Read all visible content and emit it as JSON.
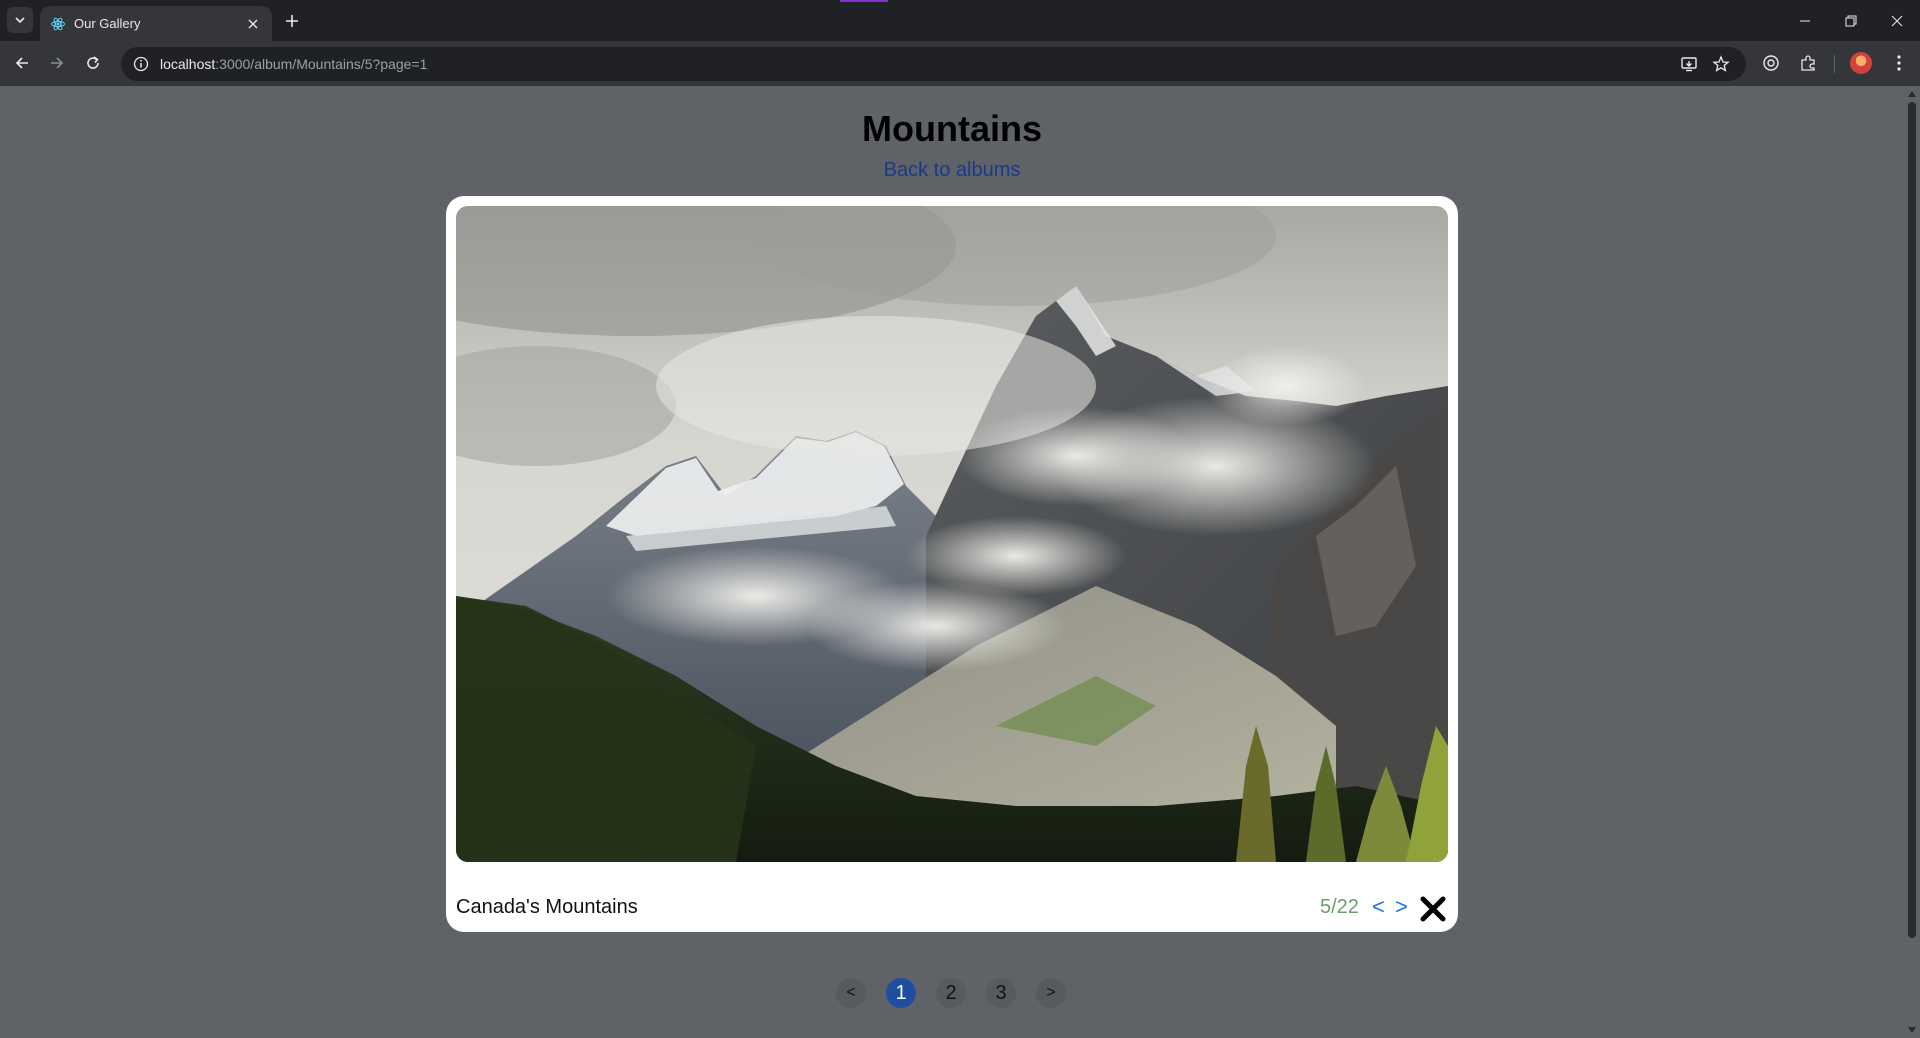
{
  "browser": {
    "tab_title": "Our Gallery",
    "url_host": "localhost",
    "url_rest": ":3000/album/Mountains/5?page=1",
    "icons": [
      "tab-list-icon",
      "react-favicon-icon",
      "close-icon",
      "plus-icon",
      "minimize-icon",
      "restore-icon",
      "close-window-icon",
      "back-icon",
      "forward-icon",
      "reload-icon",
      "site-info-icon",
      "install-app-icon",
      "bookmark-star-icon",
      "lens-icon",
      "extensions-icon",
      "profile-avatar",
      "kebab-menu-icon"
    ]
  },
  "page": {
    "title": "Mountains",
    "back_link": "Back to albums"
  },
  "viewer": {
    "caption": "Canada's Mountains",
    "counter": "5/22",
    "prev_label": "<",
    "next_label": ">",
    "photo_alt": "Snow-capped rocky mountains with clouds above a green pine forest"
  },
  "pagination": {
    "prev_label": "<",
    "next_label": ">",
    "pages": [
      "1",
      "2",
      "3"
    ],
    "current_page": "1"
  },
  "colors": {
    "page_bg": "#5f6368",
    "active_page": "#1f4ea0",
    "counter_text": "#6e9c6e",
    "nav_arrow": "#1a73e8",
    "back_link": "#1a3a8a"
  }
}
